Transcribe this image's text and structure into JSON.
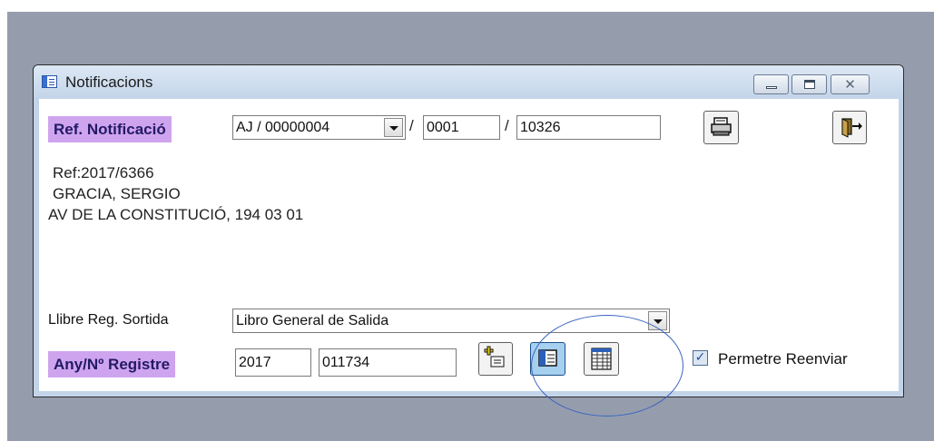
{
  "window": {
    "title": "Notificacions"
  },
  "ref": {
    "label": "Ref. Notificació",
    "part1": "AJ / 00000004",
    "part2": "0001",
    "part3": "10326",
    "sep": "/"
  },
  "info": {
    "line1": "Ref:2017/6366",
    "line2": "GRACIA, SERGIO",
    "line3": "AV DE LA CONSTITUCIÓ, 194 03 01"
  },
  "libre": {
    "label": "Llibre Reg. Sortida",
    "value": "Libro General de Salida"
  },
  "registre": {
    "label": "Any/Nº Registre",
    "year": "2017",
    "number": "011734"
  },
  "permetre": {
    "label": "Permetre Reenviar",
    "checked": true,
    "mark": "✓"
  },
  "icons": [
    "printer-icon",
    "exit-door-icon",
    "add-record-icon",
    "form-view-icon",
    "grid-view-icon"
  ],
  "colors": {
    "label_bg": "#cfa4ee",
    "label_text": "#231a66",
    "desktop": "#959dad",
    "annotation": "#3a63c0"
  }
}
